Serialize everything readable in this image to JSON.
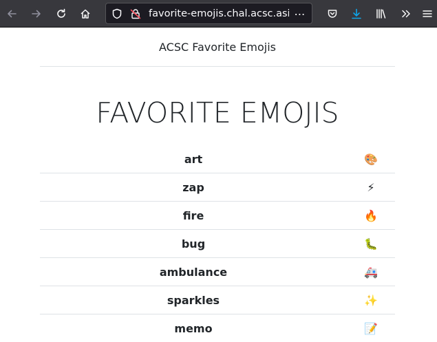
{
  "browser": {
    "url": "favorite-emojis.chal.acsc.asia",
    "overflow_indicator": "⋯"
  },
  "header": {
    "site_name": "ACSC Favorite Emojis"
  },
  "main": {
    "title": "FAVORITE EMOJIS",
    "emojis": [
      {
        "name": "art",
        "emoji": "🎨"
      },
      {
        "name": "zap",
        "emoji": "⚡"
      },
      {
        "name": "fire",
        "emoji": "🔥"
      },
      {
        "name": "bug",
        "emoji": "🐛"
      },
      {
        "name": "ambulance",
        "emoji": "🚑"
      },
      {
        "name": "sparkles",
        "emoji": "✨"
      },
      {
        "name": "memo",
        "emoji": "📝"
      }
    ]
  },
  "colors": {
    "toolbar_bg": "#38383d",
    "urlbar_bg": "#1c1b22",
    "download_accent": "#0ea5e9",
    "text": "#212529",
    "divider": "#dee2e6"
  },
  "icons": {
    "toolbar": [
      "back-icon",
      "forward-icon",
      "reload-icon",
      "home-icon",
      "pocket-icon",
      "download-icon",
      "library-icon",
      "overflow-chevron-icon",
      "menu-icon"
    ],
    "urlbar": [
      "tracking-protection-shield-icon",
      "insecure-connection-icon"
    ]
  }
}
